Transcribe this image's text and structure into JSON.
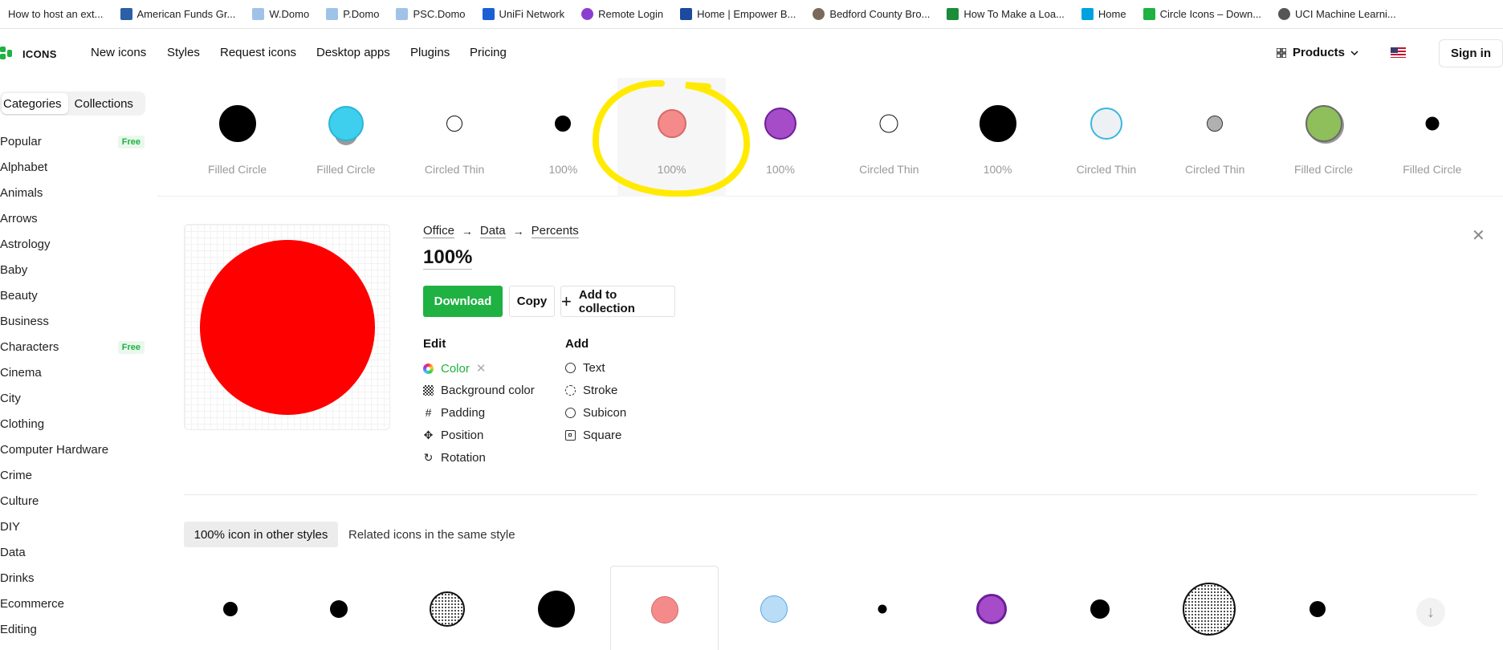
{
  "bookmarks": [
    {
      "label": "How to host an ext...",
      "icon": "blank-page-icon",
      "color": "#ffffff"
    },
    {
      "label": "American Funds Gr...",
      "icon": "funds-icon",
      "color": "#2b5fa8"
    },
    {
      "label": "W.Domo",
      "icon": "domo-icon",
      "color": "#9fc3e8"
    },
    {
      "label": "P.Domo",
      "icon": "domo-icon",
      "color": "#9fc3e8"
    },
    {
      "label": "PSC.Domo",
      "icon": "domo-icon",
      "color": "#9fc3e8"
    },
    {
      "label": "UniFi Network",
      "icon": "unifi-icon",
      "color": "#1b5fd6"
    },
    {
      "label": "Remote Login",
      "icon": "remote-icon",
      "color": "#8a3fd1"
    },
    {
      "label": "Home | Empower B...",
      "icon": "empower-icon",
      "color": "#1b4aa0"
    },
    {
      "label": "Bedford County Bro...",
      "icon": "bedford-icon",
      "color": "#7a6a5a"
    },
    {
      "label": "How To Make a Loa...",
      "icon": "w-icon",
      "color": "#1a8c3a"
    },
    {
      "label": "Home",
      "icon": "cloud-icon",
      "color": "#00a1e0"
    },
    {
      "label": "Circle Icons – Down...",
      "icon": "icons8-icon",
      "color": "#1fb141"
    },
    {
      "label": "UCI Machine Learni...",
      "icon": "globe-icon",
      "color": "#555555"
    }
  ],
  "nav": {
    "logo": "ICONS",
    "links": [
      "New icons",
      "Styles",
      "Request icons",
      "Desktop apps",
      "Plugins",
      "Pricing"
    ],
    "products": "Products",
    "sign_in": "Sign in"
  },
  "sidebar": {
    "tabs": [
      "Categories",
      "Collections"
    ],
    "free_badge": "Free",
    "categories": [
      {
        "label": "Popular",
        "free": true
      },
      {
        "label": "Alphabet",
        "free": false
      },
      {
        "label": "Animals",
        "free": false
      },
      {
        "label": "Arrows",
        "free": false
      },
      {
        "label": "Astrology",
        "free": false
      },
      {
        "label": "Baby",
        "free": false
      },
      {
        "label": "Beauty",
        "free": false
      },
      {
        "label": "Business",
        "free": false
      },
      {
        "label": "Characters",
        "free": true
      },
      {
        "label": "Cinema",
        "free": false
      },
      {
        "label": "City",
        "free": false
      },
      {
        "label": "Clothing",
        "free": false
      },
      {
        "label": "Computer Hardware",
        "free": false
      },
      {
        "label": "Crime",
        "free": false
      },
      {
        "label": "Culture",
        "free": false
      },
      {
        "label": "DIY",
        "free": false
      },
      {
        "label": "Data",
        "free": false
      },
      {
        "label": "Drinks",
        "free": false
      },
      {
        "label": "Ecommerce",
        "free": false
      },
      {
        "label": "Editing",
        "free": false
      }
    ]
  },
  "strip": [
    {
      "label": "Filled Circle",
      "fill": "#000000",
      "border": "#000000"
    },
    {
      "label": "Filled Circle",
      "fill": "#3fcfee",
      "border": "#2bb4d6"
    },
    {
      "label": "Circled Thin",
      "fill": "#ffffff",
      "border": "#111111"
    },
    {
      "label": "100%",
      "fill": "#000000",
      "border": "#000000"
    },
    {
      "label": "100%",
      "fill": "#f58a8a",
      "border": "#d46a6a",
      "selected": true
    },
    {
      "label": "100%",
      "fill": "#a64cc8",
      "border": "#6b1f9a"
    },
    {
      "label": "Circled Thin",
      "fill": "#ffffff",
      "border": "#111111"
    },
    {
      "label": "100%",
      "fill": "#000000",
      "border": "#000000"
    },
    {
      "label": "Circled Thin",
      "fill": "#eef1f4",
      "border": "#3ab6e0"
    },
    {
      "label": "Circled Thin",
      "fill": "#b0b0b0",
      "border": "#333333"
    },
    {
      "label": "Filled Circle",
      "fill": "#8fbf5a",
      "border": "#6a6a6a"
    },
    {
      "label": "Filled Circle",
      "fill": "#000000",
      "border": "#000000"
    }
  ],
  "detail": {
    "breadcrumbs": [
      "Office",
      "Data",
      "Percents"
    ],
    "title": "100%",
    "preview_color": "#ff0000",
    "download": "Download",
    "copy": "Copy",
    "add_to_collection": "Add to collection",
    "edit_heading": "Edit",
    "add_heading": "Add",
    "edit_options": [
      "Color",
      "Background color",
      "Padding",
      "Position",
      "Rotation"
    ],
    "add_options": [
      "Text",
      "Stroke",
      "Subicon",
      "Square"
    ]
  },
  "other_styles": {
    "tab_active": "100% icon in other styles",
    "tab_other": "Related icons in the same style"
  },
  "colors": {
    "brand_green": "#1fb141",
    "highlight_yellow": "#ffea00"
  }
}
